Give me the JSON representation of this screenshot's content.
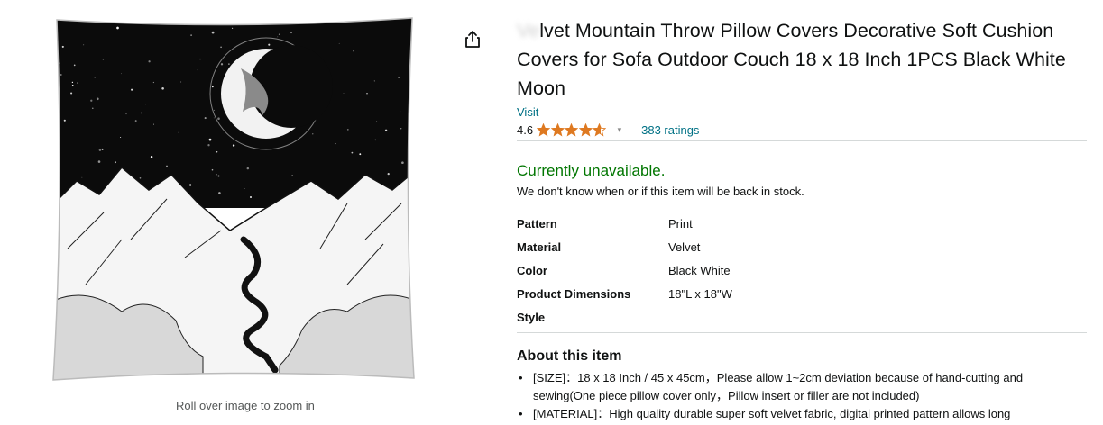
{
  "product": {
    "title_masked": "Ve",
    "title": "lvet Mountain Throw Pillow Covers Decorative Soft Cushion Covers for Sofa Outdoor Couch 18 x 18 Inch 1PCS Black White Moon",
    "store_link": "Visit",
    "rating": "4.6",
    "stars": 4.6,
    "ratings_count": "383 ratings"
  },
  "image": {
    "zoom_hint": "Roll over image to zoom in",
    "share_icon": "share-icon"
  },
  "availability": {
    "status": "Currently unavailable.",
    "note": "We don't know when or if this item will be back in stock.",
    "status_color": "#007600"
  },
  "specs": [
    {
      "key": "Pattern",
      "value": "Print"
    },
    {
      "key": "Material",
      "value": "Velvet"
    },
    {
      "key": "Color",
      "value": "Black White"
    },
    {
      "key": "Product Dimensions",
      "value": "18\"L x 18\"W"
    },
    {
      "key": "Style",
      "value": ""
    }
  ],
  "about": {
    "heading": "About this item",
    "bullets": [
      "[SIZE]：18 x 18 Inch / 45 x 45cm，Please allow 1~2cm deviation because of hand-cutting and sewing(One piece pillow cover only，Pillow insert or filler are not included)",
      "[MATERIAL]：High quality durable super soft velvet fabric, digital printed pattern allows long"
    ]
  },
  "colors": {
    "link": "#007185",
    "star": "#de7921",
    "divider": "#d5d9d9"
  }
}
